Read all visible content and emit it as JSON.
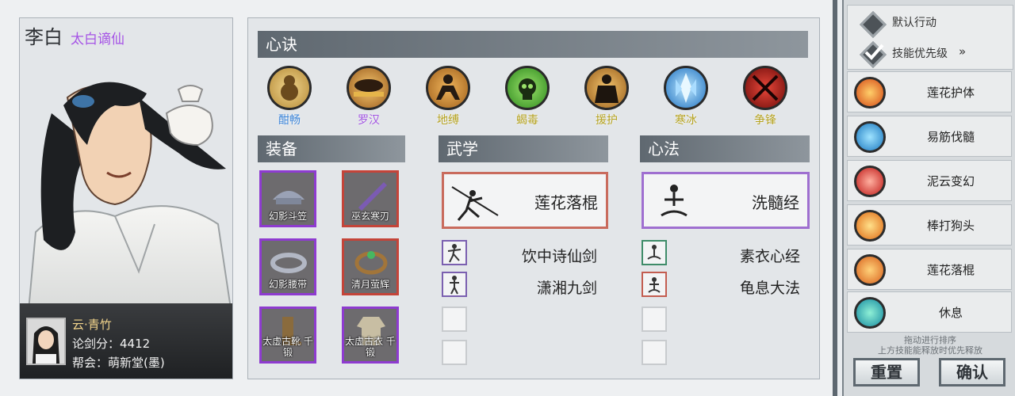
{
  "character": {
    "name": "李白",
    "title": "太白谪仙"
  },
  "player": {
    "name": "云·青竹",
    "score": "论剑分：4412",
    "guild": "帮会：萌新堂(墨)"
  },
  "sections": {
    "xinjue": "心诀",
    "equipment": "装备",
    "wuxue": "武学",
    "xinfa": "心法"
  },
  "xinjue_items": [
    {
      "label": "酣畅",
      "icon": "gourd-icon",
      "color": "#d7b45a"
    },
    {
      "label": "罗汉",
      "icon": "monk-icon",
      "color": "#e8a640"
    },
    {
      "label": "地缚",
      "icon": "crawling-figure-icon",
      "color": "#d8922a"
    },
    {
      "label": "蝎毒",
      "icon": "poison-skull-icon",
      "color": "#57c03a"
    },
    {
      "label": "援护",
      "icon": "guard-figure-icon",
      "color": "#d98e23"
    },
    {
      "label": "寒冰",
      "icon": "ice-crystal-icon",
      "color": "#3fa8e8"
    },
    {
      "label": "争锋",
      "icon": "crossed-blades-icon",
      "color": "#c8221a"
    }
  ],
  "equipment": [
    {
      "name": "幻影斗笠",
      "rarity": "purple",
      "icon": "hat-icon"
    },
    {
      "name": "巫玄寒刃",
      "rarity": "red",
      "icon": "blade-icon"
    },
    {
      "name": "幻影腰带",
      "rarity": "purple",
      "icon": "belt-icon"
    },
    {
      "name": "清月萤辉",
      "rarity": "red",
      "icon": "ring-icon"
    },
    {
      "name": "太虚古靴 千锻",
      "rarity": "purple",
      "icon": "boots-icon"
    },
    {
      "name": "太虚古衣 千锻",
      "rarity": "purple",
      "icon": "robe-icon"
    }
  ],
  "wuxue": {
    "main": "莲花落棍",
    "others": [
      "饮中诗仙剑",
      "潇湘九剑"
    ]
  },
  "xinfa": {
    "main": "洗髓经",
    "others": [
      "素衣心经",
      "龟息大法"
    ]
  },
  "right_panel": {
    "option_default": "默认行动",
    "option_priority": "技能优先级",
    "priority_arrow": "»",
    "skills": [
      {
        "label": "莲花护体",
        "icon": "flame-swirl-icon",
        "color": "#e7762a"
      },
      {
        "label": "易筋伐髓",
        "icon": "meditating-figure-icon",
        "color": "#2f9fe0"
      },
      {
        "label": "泥云变幻",
        "icon": "red-swirl-icon",
        "color": "#d8322a"
      },
      {
        "label": "棒打狗头",
        "icon": "fire-icon",
        "color": "#e8821e"
      },
      {
        "label": "莲花落棍",
        "icon": "staff-fighter-icon",
        "color": "#e3772a"
      },
      {
        "label": "休息",
        "icon": "rest-figure-icon",
        "color": "#2a9bb5"
      }
    ],
    "hint_line1": "拖动进行排序",
    "hint_line2": "上方技能能释放时优先释放",
    "reset_button": "重置",
    "confirm_button": "确认"
  }
}
